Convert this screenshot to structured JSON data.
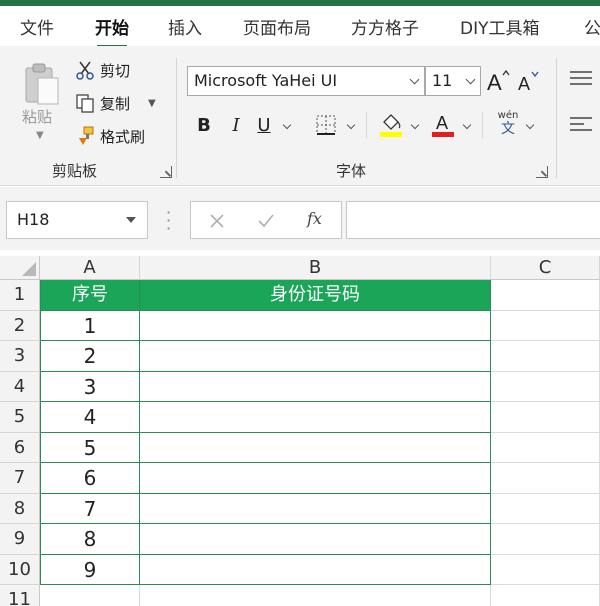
{
  "menu": {
    "tabs": [
      "文件",
      "开始",
      "插入",
      "页面布局",
      "方方格子",
      "DIY工具箱",
      "公"
    ],
    "active": "开始"
  },
  "ribbon": {
    "clipboard": {
      "paste": "粘贴",
      "cut": "剪切",
      "copy": "复制",
      "format_painter": "格式刷",
      "group_label": "剪贴板"
    },
    "font": {
      "font_name": "Microsoft YaHei UI",
      "font_size": "11",
      "bold": "B",
      "italic": "I",
      "underline": "U",
      "font_color_letter": "A",
      "phonetic_top": "wén",
      "phonetic_bottom": "文",
      "group_label": "字体",
      "highlight_color": "#ffff00",
      "font_color": "#e02020"
    }
  },
  "formula_bar": {
    "name_box": "H18",
    "fx": "fx",
    "value": ""
  },
  "sheet": {
    "columns": [
      "A",
      "B",
      "C"
    ],
    "rows": [
      "1",
      "2",
      "3",
      "4",
      "5",
      "6",
      "7",
      "8",
      "9",
      "10",
      "11"
    ],
    "header_row": [
      "序号",
      "身份证号码"
    ],
    "data": [
      "1",
      "2",
      "3",
      "4",
      "5",
      "6",
      "7",
      "8",
      "9"
    ],
    "header_fill": "#1aa559",
    "table_border": "#2e8b57"
  }
}
